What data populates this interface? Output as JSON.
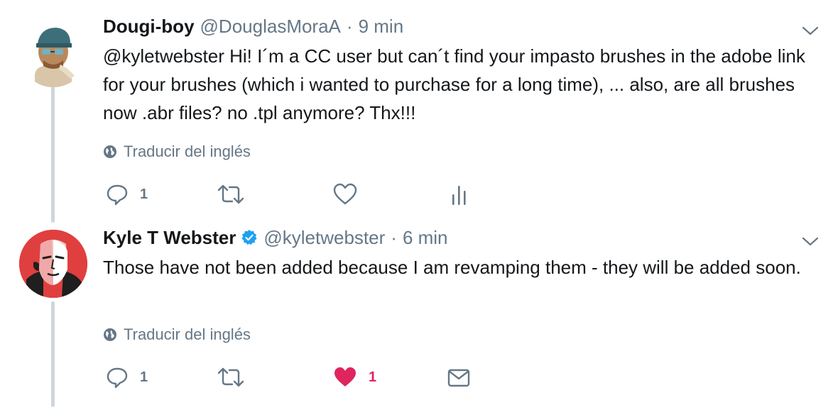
{
  "tweets": [
    {
      "name": "Dougi-boy",
      "handle": "@DouglasMoraA",
      "separator": "·",
      "time": "9 min",
      "mention": "@kyletwebster",
      "text": " Hi! I´m a CC user but can´t find your impasto brushes in the adobe link for your brushes (which i wanted to purchase for a long time), ... also, are all brushes now .abr files? no .tpl anymore? Thx!!!",
      "translate": "Traducir del inglés",
      "reply_count": "1",
      "verified": false,
      "liked": false
    },
    {
      "name": "Kyle T Webster",
      "handle": "@kyletwebster",
      "separator": "·",
      "time": "6 min",
      "text": "Those have not been added because I am revamping them - they will be added soon.",
      "translate": "Traducir del inglés",
      "reply_count": "1",
      "like_count": "1",
      "verified": true,
      "liked": true
    }
  ],
  "colors": {
    "muted": "#657786",
    "like": "#e0245e",
    "verified": "#1da1f2",
    "thread_line": "#ccd6dd"
  }
}
